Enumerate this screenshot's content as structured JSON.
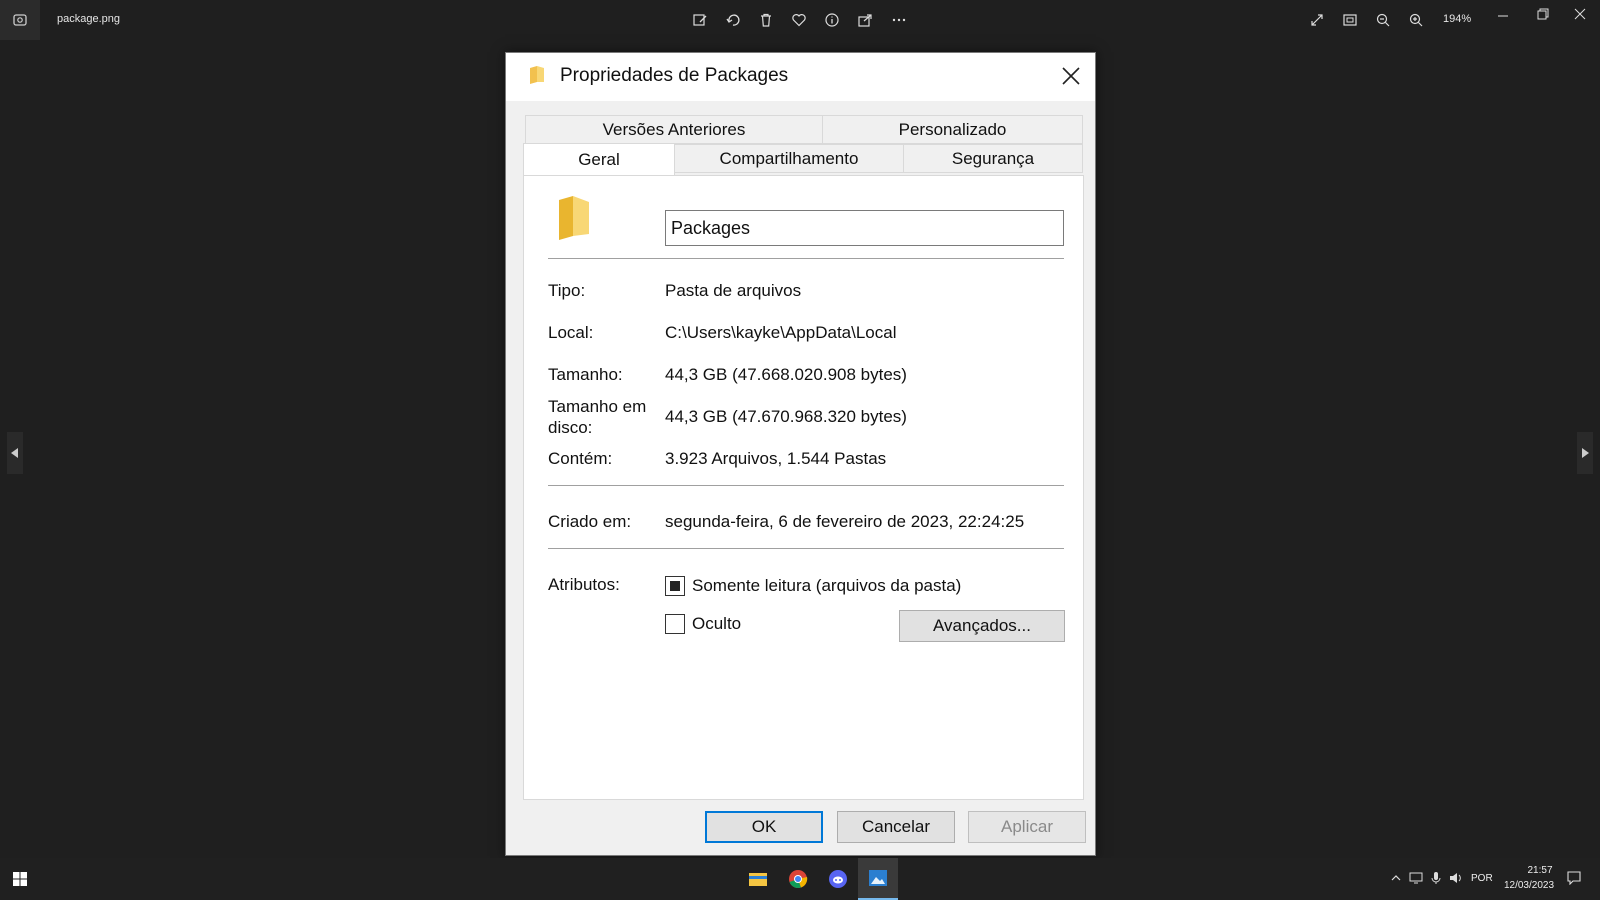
{
  "viewer": {
    "file_name": "package.png",
    "zoom": "194%"
  },
  "dialog": {
    "title": "Propriedades de Packages",
    "tabs": {
      "row1": [
        "Versões Anteriores",
        "Personalizado"
      ],
      "row2": [
        "Geral",
        "Compartilhamento",
        "Segurança"
      ]
    },
    "name_value": "Packages",
    "fields": {
      "tipo_label": "Tipo:",
      "tipo_value": "Pasta de arquivos",
      "local_label": "Local:",
      "local_value": "C:\\Users\\kayke\\AppData\\Local",
      "tamanho_label": "Tamanho:",
      "tamanho_value": "44,3 GB (47.668.020.908 bytes)",
      "disco_label_1": "Tamanho em",
      "disco_label_2": "disco:",
      "disco_value": "44,3 GB (47.670.968.320 bytes)",
      "contem_label": "Contém:",
      "contem_value": "3.923 Arquivos, 1.544 Pastas",
      "criado_label": "Criado em:",
      "criado_value": "segunda-feira, 6 de fevereiro de 2023, 22:24:25",
      "atributos_label": "Atributos:"
    },
    "attributes": {
      "readonly_label": "Somente leitura (arquivos da pasta)",
      "readonly_state": "indeterminate",
      "hidden_label": "Oculto",
      "hidden_state": "unchecked",
      "advanced_label": "Avançados..."
    },
    "buttons": {
      "ok": "OK",
      "cancel": "Cancelar",
      "apply": "Aplicar"
    }
  },
  "taskbar": {
    "apps": [
      "file-explorer-icon",
      "chrome-icon",
      "discord-icon",
      "photos-icon"
    ],
    "language": "POR",
    "time": "21:57",
    "date": "12/03/2023"
  },
  "colors": {
    "viewer_bg": "#1f1f1f",
    "dialog_bg": "#f0f0f0",
    "accent": "#0078d7",
    "folder": "#f4c542"
  }
}
